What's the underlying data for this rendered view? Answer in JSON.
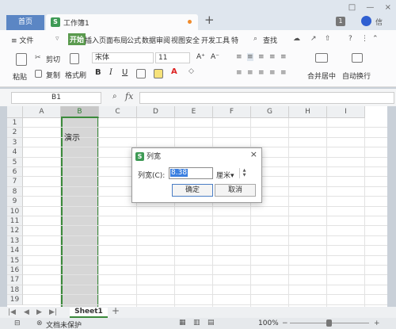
{
  "titlebar": {
    "home_tab": "首页",
    "doc_tab": "工作簿1",
    "logo_letter": "S",
    "add_tab": "+",
    "badge": "1",
    "user": "信",
    "win_controls": [
      "□",
      "—",
      "×"
    ]
  },
  "menu": {
    "file": "≡ 文件",
    "items": [
      "开始",
      "插入",
      "页面布局",
      "公式",
      "数据",
      "审阅",
      "视图",
      "安全",
      "开发工具",
      "特"
    ],
    "search": "查找"
  },
  "ribbon": {
    "paste": "粘贴",
    "cut": "剪切",
    "copy": "复制",
    "format_painter": "格式刷",
    "font_name": "宋体",
    "font_size": "11",
    "bold": "B",
    "italic": "I",
    "underline": "U",
    "grow": "A⁺",
    "shrink": "A⁻",
    "merge": "合并居中",
    "wrap": "自动换行"
  },
  "formula_bar": {
    "name_box": "B1",
    "fx": "fx"
  },
  "sheet": {
    "columns": [
      "A",
      "B",
      "C",
      "D",
      "E",
      "F",
      "G",
      "H",
      "I"
    ],
    "selected_column": "B",
    "rows": [
      "1",
      "2",
      "3",
      "4",
      "5",
      "6",
      "7",
      "8",
      "9",
      "10",
      "11",
      "12",
      "13",
      "14",
      "15",
      "16",
      "17",
      "18",
      "19"
    ],
    "cell_b2": "演示"
  },
  "dialog": {
    "title": "列宽",
    "label": "列宽(C):",
    "value": "8.38",
    "unit": "厘米",
    "ok": "确定",
    "cancel": "取消",
    "close": "×"
  },
  "bottom": {
    "sheet_tab": "Sheet1",
    "protect": "文档未保护",
    "zoom": "100%"
  }
}
